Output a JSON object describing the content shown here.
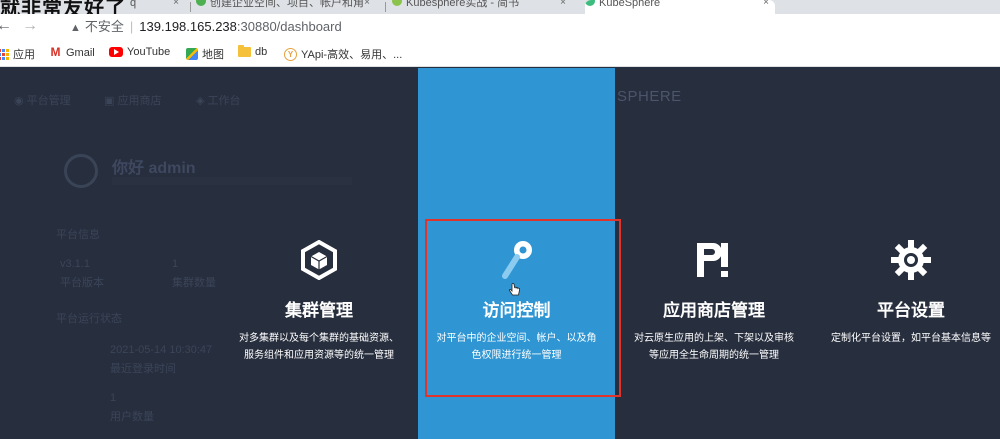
{
  "browser": {
    "watermark_text": "就非常友好了",
    "tabs": [
      {
        "label": "q"
      },
      {
        "label": "创建企业空间、项目、帐户和角"
      },
      {
        "label": "Kubesphere实战 - 简书"
      },
      {
        "label": "KubeSphere"
      }
    ],
    "tab_close": "×",
    "nav_back": "←",
    "nav_forward": "→",
    "address": {
      "warning_icon": "▲",
      "insecure_label": "不安全",
      "separator": "|",
      "host": "139.198.165.238",
      "path": ":30880/dashboard"
    },
    "bookmarks": [
      {
        "label": "应用",
        "icon": "apps-icon"
      },
      {
        "label": "Gmail",
        "icon": "gmail-icon"
      },
      {
        "label": "YouTube",
        "icon": "youtube-icon"
      },
      {
        "label": "地图",
        "icon": "maps-icon"
      },
      {
        "label": "db",
        "icon": "folder-icon"
      },
      {
        "label": "YApi-高效、易用、...",
        "icon": "yapi-icon"
      }
    ]
  },
  "background": {
    "nav_items": [
      "平台管理",
      "应用商店",
      "工作台"
    ],
    "logo_partial": "SPHERE",
    "greeting": "你好 admin",
    "section_platform_info": "平台信息",
    "version": "v3.1.1",
    "version_label": "平台版本",
    "cluster_count": "1",
    "cluster_label": "集群数量",
    "section_platform_runtime": "平台运行状态",
    "last_login_time": "2021-05-14 10:30:47",
    "last_login_label": "最近登录时间",
    "account_count": "1",
    "account_label": "用户数量"
  },
  "menu": [
    {
      "title": "集群管理",
      "desc_lines": [
        "对多集群以及每个集群的基础资源、",
        "服务组件和应用资源等的统一管理"
      ],
      "icon": "cluster-icon",
      "active": false
    },
    {
      "title": "访问控制",
      "desc_lines": [
        "对平台中的企业空间、帐户、以及角",
        "色权限进行统一管理"
      ],
      "icon": "key-icon",
      "active": true
    },
    {
      "title": "应用商店管理",
      "desc_lines": [
        "对云原生应用的上架、下架以及审核",
        "等应用全生命周期的统一管理"
      ],
      "icon": "app-store-icon",
      "active": false
    },
    {
      "title": "平台设置",
      "desc_lines": [
        "定制化平台设置，如平台基本信息等"
      ],
      "icon": "gear-icon",
      "active": false
    }
  ],
  "colors": {
    "active_column": "#2f96d3",
    "overlay_bg": "#272e3d",
    "highlight_box": "#e2322c"
  }
}
